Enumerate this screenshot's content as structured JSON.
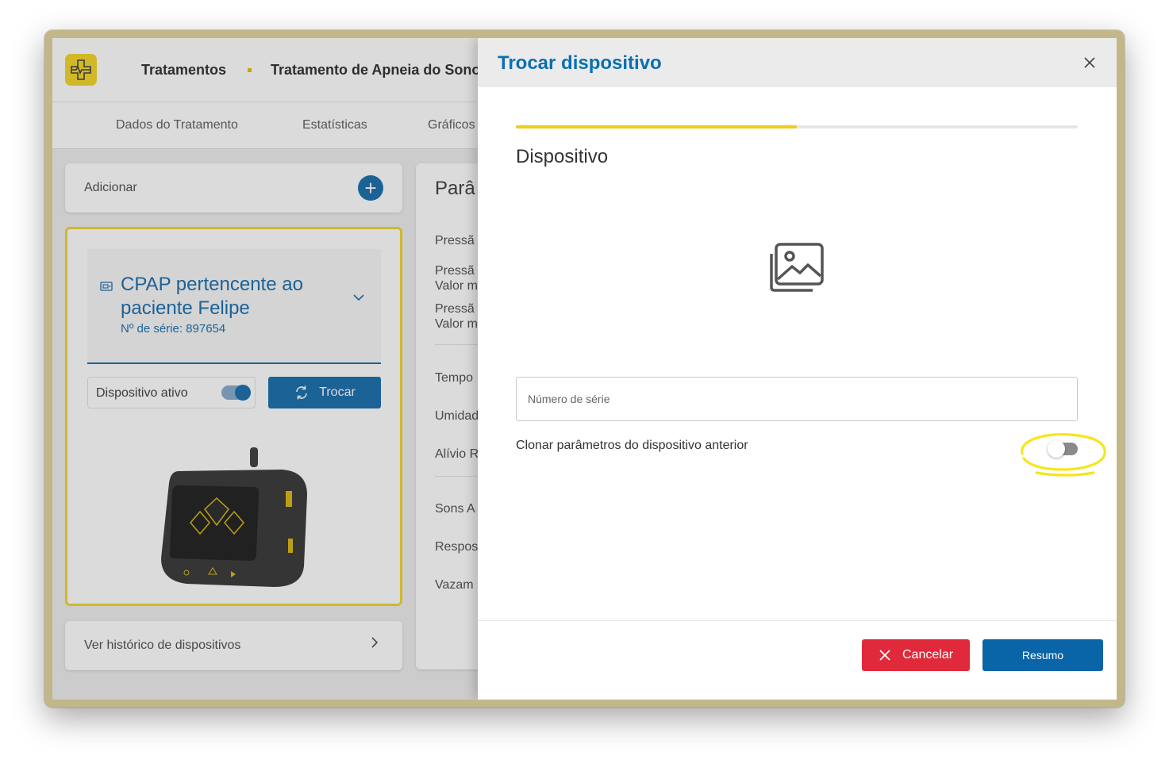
{
  "header": {
    "breadcrumb_1": "Tratamentos",
    "breadcrumb_2": "Tratamento de Apneia do Sono",
    "logo_icon": "medical-cross-heartbeat-icon"
  },
  "tabs": [
    "Dados do Tratamento",
    "Estatísticas",
    "Gráficos"
  ],
  "left_panel": {
    "add_label": "Adicionar",
    "device": {
      "title": "CPAP pertencente ao paciente Felipe",
      "serial": "Nº de série: 897654",
      "active_label": "Dispositivo ativo",
      "active": true,
      "swap_label": "Trocar"
    },
    "history_label": "Ver histórico de dispositivos"
  },
  "params_panel": {
    "title": "Parâ",
    "items": [
      "Pressã",
      "Pressã",
      "Valor m",
      "Pressã",
      "Valor m",
      "Tempo",
      "Umidad",
      "Alívio R",
      "Sons A",
      "Respos",
      "Vazam"
    ]
  },
  "modal": {
    "title": "Trocar dispositivo",
    "progress": 0.5,
    "step_title": "Dispositivo",
    "serial_placeholder": "Número de série",
    "serial_value": "",
    "clone_label": "Clonar parâmetros do dispositivo anterior",
    "clone_enabled": false,
    "cancel_label": "Cancelar",
    "summary_label": "Resumo"
  },
  "colors": {
    "accent": "#0a64a8",
    "highlight": "#f0d41c",
    "danger": "#e0293a"
  }
}
